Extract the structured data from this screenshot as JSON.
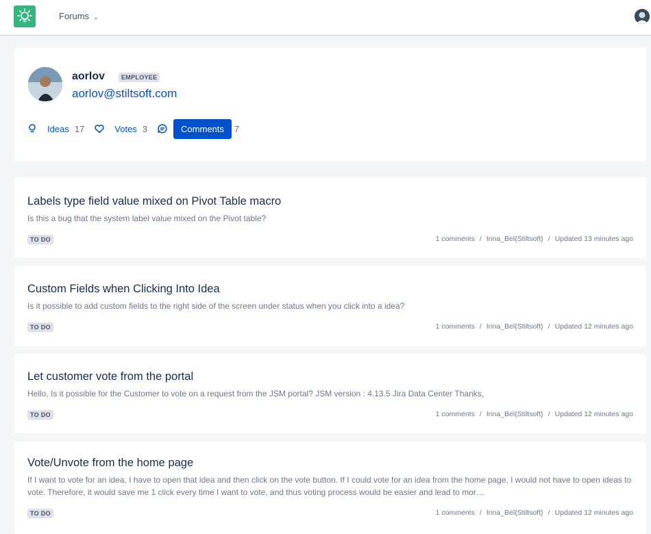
{
  "header": {
    "logo_icon": "lightbulb-icon",
    "forums_label": "Forums",
    "forums_chevron": "⌄"
  },
  "profile": {
    "username": "aorlov",
    "badge": "EMPLOYEE",
    "email": "aorlov@stiltsoft.com",
    "stats": {
      "ideas_label": "Ideas",
      "ideas_count": "17",
      "votes_label": "Votes",
      "votes_count": "3",
      "comments_label": "Comments",
      "comments_count": "7"
    }
  },
  "ideas": [
    {
      "title": "Labels type field value mixed on Pivot Table macro",
      "desc": "Is this a bug that the system label value mixed on the Pivot table?",
      "status": "TO DO",
      "comments": "1 comments",
      "author": "Irina_Bel{Stiltsoft}",
      "updated": "Updated 13 minutes ago"
    },
    {
      "title": "Custom Fields when Clicking Into Idea",
      "desc": "Is it possible to add custom fields to the right side of the screen under status when you click into a idea?",
      "status": "TO DO",
      "comments": "1 comments",
      "author": "Irina_Bel{Stiltsoft}",
      "updated": "Updated 12 minutes ago"
    },
    {
      "title": "Let customer vote from the portal",
      "desc": "Hello, Is it possible for the Customer to vote on a request from the JSM portal? JSM version : 4.13.5 Jira Data Center Thanks,",
      "status": "TO DO",
      "comments": "1 comments",
      "author": "Irina_Bel{Stiltsoft}",
      "updated": "Updated 12 minutes ago"
    },
    {
      "title": "Vote/Unvote from the home page",
      "desc": "If I want to vote for an idea, I have to open that idea and then click on the vote button. If I could vote for an idea from the home page, I would not have to open ideas to vote. Therefore, it would save me 1 click every time I want to vote, and thus voting process would be easier and lead to mor…",
      "status": "TO DO",
      "comments": "1 comments",
      "author": "Irina_Bel{Stiltsoft}",
      "updated": "Updated 12 minutes ago"
    }
  ],
  "meta_separator": "/"
}
